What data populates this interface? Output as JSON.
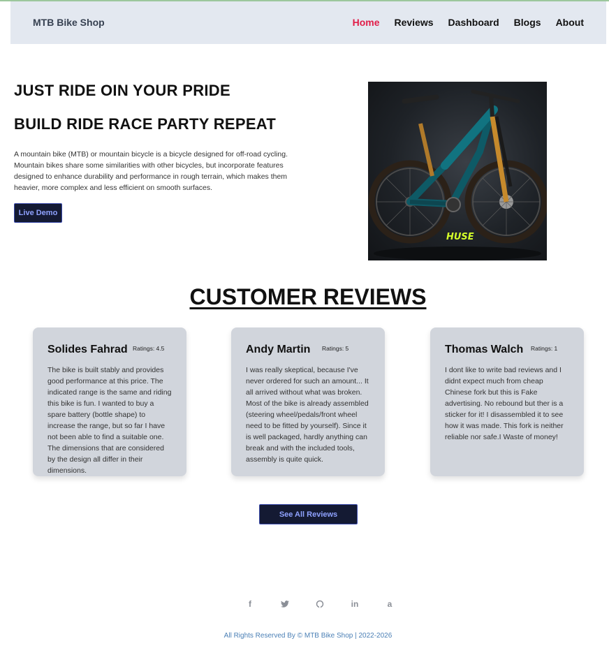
{
  "navbar": {
    "brand": "MTB Bike Shop",
    "links": [
      {
        "label": "Home",
        "active": true
      },
      {
        "label": "Reviews",
        "active": false
      },
      {
        "label": "Dashboard",
        "active": false
      },
      {
        "label": "Blogs",
        "active": false
      },
      {
        "label": "About",
        "active": false
      }
    ]
  },
  "hero": {
    "title_line1": "JUST RIDE OIN YOUR PRIDE",
    "title_line2": "BUILD RIDE RACE PARTY REPEAT",
    "description": "A mountain bike (MTB) or mountain bicycle is a bicycle designed for off-road cycling. Mountain bikes share some similarities with other bicycles, but incorporate features designed to enhance durability and performance in rough terrain, which makes them heavier, more complex and less efficient on smooth surfaces.",
    "button_label": "Live Demo",
    "image_logo_text": "HUSE"
  },
  "reviews": {
    "section_title": "CUSTOMER REVIEWS",
    "cards": [
      {
        "name": "Solides Fahrad",
        "rating": "Ratings: 4.5",
        "text": "The bike is built stably and provides good performance at this price. The indicated range is the same and riding this bike is fun. I wanted to buy a spare battery (bottle shape) to increase the range, but so far I have not been able to find a suitable one. The dimensions that are considered by the design all differ in their dimensions."
      },
      {
        "name": "Andy Martin",
        "rating": "Ratings: 5",
        "text": "I was really skeptical, because I've never ordered for such an amount... It all arrived without what was broken. Most of the bike is already assembled (steering wheel/pedals/front wheel need to be fitted by yourself). Since it is well packaged, hardly anything can break and with the included tools, assembly is quite quick."
      },
      {
        "name": "Thomas Walch",
        "rating": "Ratings: 1",
        "text": "I dont like to write bad reviews and I didnt expect much from cheap Chinese fork but this is Fake advertising. No rebound but ther is a sticker for it! I disassembled it to see how it was made. This fork is neither reliable nor safe.I Waste of money!"
      }
    ],
    "see_all_label": "See All Reviews"
  },
  "footer": {
    "social_icons": [
      "facebook-icon",
      "twitter-icon",
      "github-icon",
      "linkedin-icon",
      "amazon-icon"
    ],
    "social_glyphs": [
      "f",
      "🐦",
      "◯",
      "in",
      "a"
    ],
    "copyright": "All Rights Reserved By © MTB Bike Shop | 2022-2026"
  },
  "colors": {
    "navbar_bg": "#e3e8f0",
    "active_link": "#e11d48",
    "button_bg": "#141a33",
    "button_text": "#8fa2ff",
    "card_bg": "#d1d5dc",
    "copyright": "#4a7fb5"
  }
}
